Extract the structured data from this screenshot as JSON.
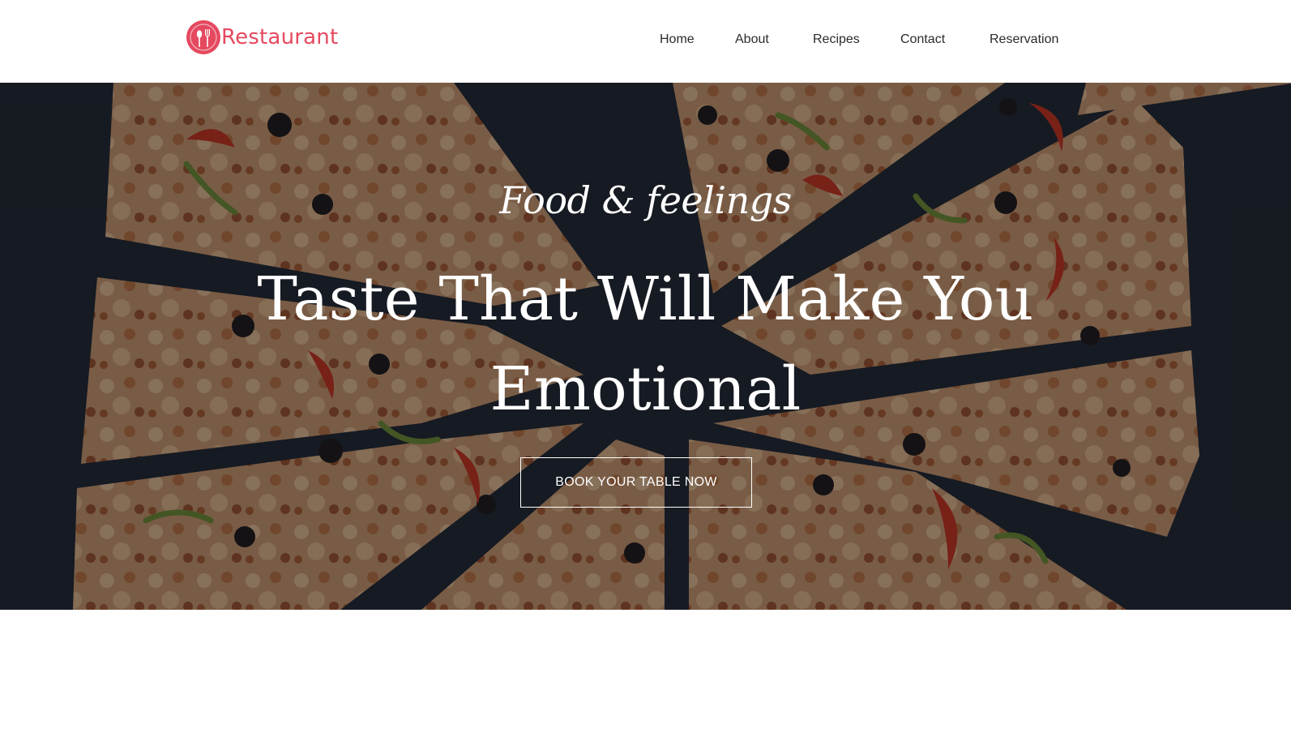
{
  "brand": {
    "name": "Restaurant",
    "logo_icon": "spoon-fork-icon",
    "accent_color": "#e5495f"
  },
  "nav": {
    "items": [
      {
        "label": "Home"
      },
      {
        "label": "About"
      },
      {
        "label": "Recipes"
      },
      {
        "label": "Contact"
      },
      {
        "label": "Reservation"
      }
    ]
  },
  "hero": {
    "tagline": "Food & feelings",
    "headline": "Taste That Will Make You Emotional",
    "cta_label": "BOOK YOUR TABLE NOW",
    "background": "pizza-slices-photo"
  }
}
